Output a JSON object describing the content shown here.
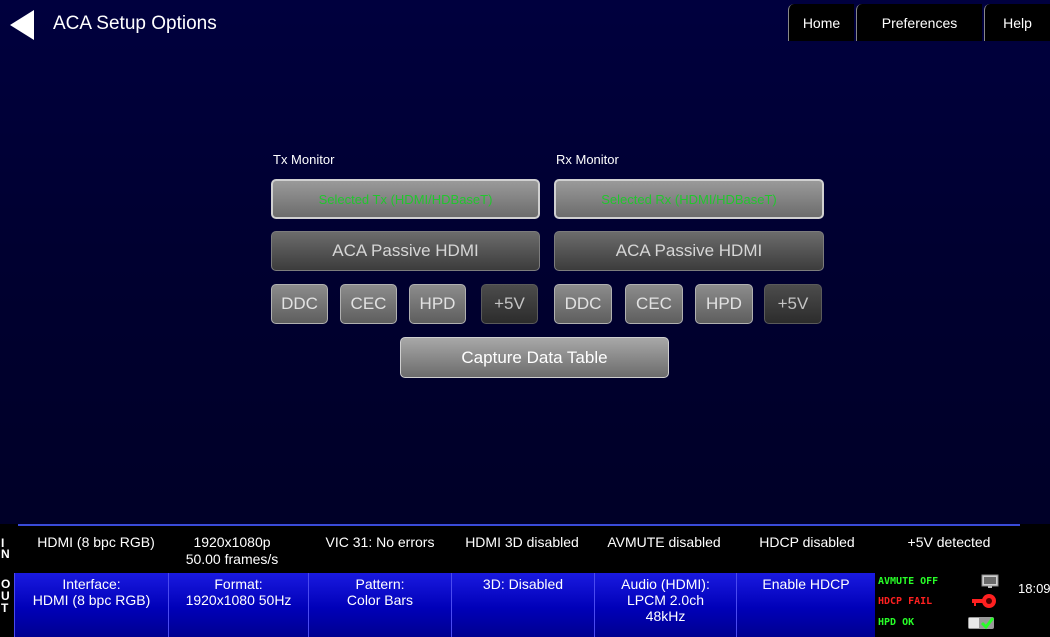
{
  "header": {
    "title": "ACA Setup Options",
    "tabs": [
      {
        "label": "Home"
      },
      {
        "label": "Preferences"
      },
      {
        "label": "Help"
      }
    ]
  },
  "tx": {
    "label": "Tx Monitor",
    "select": "Selected Tx (HDMI/HDBaseT)",
    "mode": "ACA Passive HDMI",
    "signals": [
      "DDC",
      "CEC",
      "HPD",
      "+5V"
    ]
  },
  "rx": {
    "label": "Rx Monitor",
    "select": "Selected Rx (HDMI/HDBaseT)",
    "mode": "ACA Passive HDMI",
    "signals": [
      "DDC",
      "CEC",
      "HPD",
      "+5V"
    ]
  },
  "capture_label": "Capture Data Table",
  "in_bar": {
    "side_label": [
      "I",
      "N"
    ],
    "interface": "HDMI (8 bpc RGB)",
    "format_line1": "1920x1080p",
    "format_line2": "50.00 frames/s",
    "vic": "VIC 31: No errors",
    "hdmi3d": "HDMI 3D disabled",
    "avmute": "AVMUTE disabled",
    "hdcp": "HDCP disabled",
    "power": "+5V detected"
  },
  "out_bar": {
    "side_label": [
      "O",
      "U",
      "T"
    ],
    "interface": [
      "Interface:",
      "HDMI (8 bpc RGB)"
    ],
    "format": [
      "Format:",
      "1920x1080 50Hz"
    ],
    "pattern": [
      "Pattern:",
      "Color Bars"
    ],
    "threed": "3D: Disabled",
    "audio": [
      "Audio (HDMI):",
      "LPCM 2.0ch",
      "48kHz"
    ],
    "hdcp": "Enable HDCP",
    "status": {
      "avmute": "AVMUTE OFF",
      "hdcp": "HDCP FAIL",
      "hpd": "HPD OK"
    },
    "time": "18:09"
  },
  "icons": [
    "back-arrow-icon",
    "monitor-icon",
    "key-icon",
    "toggle-switch-icon"
  ],
  "colors": {
    "background": "#00003e",
    "selected_text": "#22c52e",
    "out_cell": "#0000c8",
    "status_green": "#28ff28",
    "status_red": "#ff2020"
  }
}
